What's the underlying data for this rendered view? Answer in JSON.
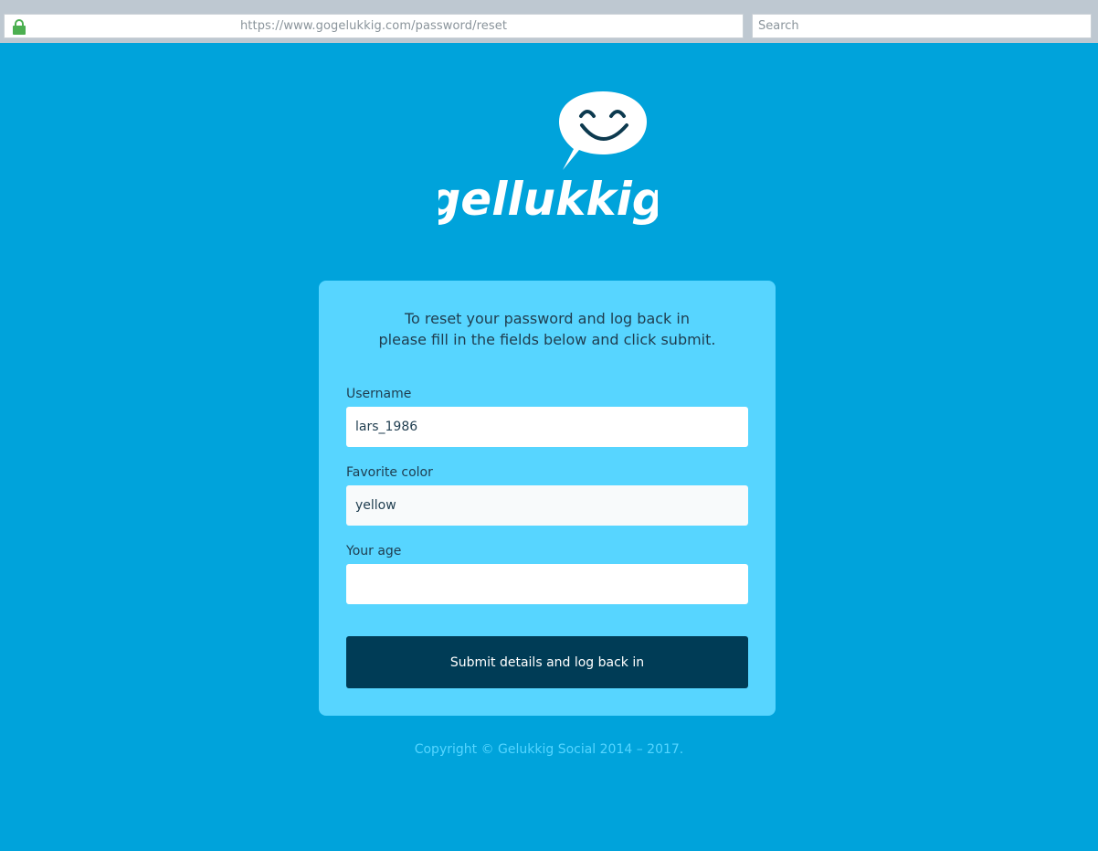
{
  "browser": {
    "url": "https://www.gogelukkig.com/password/reset",
    "search_placeholder": "Search",
    "lock_icon": "lock-icon"
  },
  "logo": {
    "wordmark": "gellukkig",
    "icon": "smiley-speech-bubble-icon"
  },
  "form": {
    "intro_line1": "To reset your password and log back in",
    "intro_line2": "please fill in the fields below and click submit.",
    "fields": [
      {
        "label": "Username",
        "value": "lars_1986"
      },
      {
        "label": "Favorite color",
        "value": "yellow"
      },
      {
        "label": "Your age",
        "value": ""
      }
    ],
    "submit_label": "Submit details and log back in"
  },
  "footer": {
    "copyright": "Copyright © Gelukkig Social 2014 – 2017."
  },
  "colors": {
    "page_background": "#00a3db",
    "card_background": "#57d5ff",
    "button_background": "#003c56",
    "lock_green": "#4caf50"
  }
}
